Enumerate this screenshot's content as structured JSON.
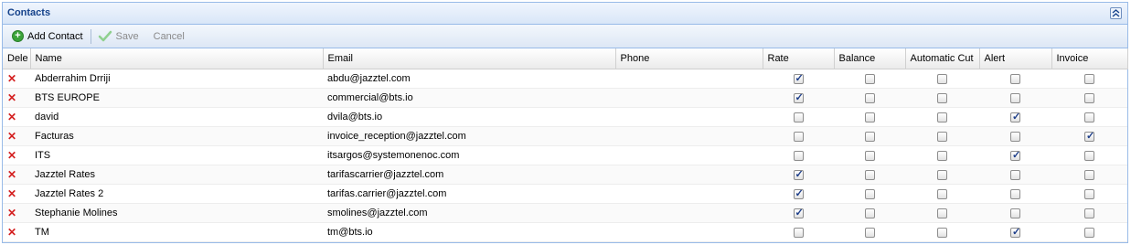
{
  "panel": {
    "title": "Contacts"
  },
  "toolbar": {
    "add_label": "Add Contact",
    "save_label": "Save",
    "cancel_label": "Cancel"
  },
  "columns": [
    "Dele",
    "Name",
    "Email",
    "Phone",
    "Rate",
    "Balance",
    "Automatic Cut",
    "Alert",
    "Invoice"
  ],
  "contacts": [
    {
      "name": "Abderrahim Drriji",
      "email": "abdu@jazztel.com",
      "phone": "",
      "rate": true,
      "balance": false,
      "automatic_cut": false,
      "alert": false,
      "invoice": false
    },
    {
      "name": "BTS EUROPE",
      "email": "commercial@bts.io",
      "phone": "",
      "rate": true,
      "balance": false,
      "automatic_cut": false,
      "alert": false,
      "invoice": false
    },
    {
      "name": "david",
      "email": "dvila@bts.io",
      "phone": "",
      "rate": false,
      "balance": false,
      "automatic_cut": false,
      "alert": true,
      "invoice": false
    },
    {
      "name": "Facturas",
      "email": "invoice_reception@jazztel.com",
      "phone": "",
      "rate": false,
      "balance": false,
      "automatic_cut": false,
      "alert": false,
      "invoice": true
    },
    {
      "name": "ITS",
      "email": "itsargos@systemonenoc.com",
      "phone": "",
      "rate": false,
      "balance": false,
      "automatic_cut": false,
      "alert": true,
      "invoice": false
    },
    {
      "name": "Jazztel Rates",
      "email": "tarifascarrier@jazztel.com",
      "phone": "",
      "rate": true,
      "balance": false,
      "automatic_cut": false,
      "alert": false,
      "invoice": false
    },
    {
      "name": "Jazztel Rates 2",
      "email": "tarifas.carrier@jazztel.com",
      "phone": "",
      "rate": true,
      "balance": false,
      "automatic_cut": false,
      "alert": false,
      "invoice": false
    },
    {
      "name": "Stephanie Molines",
      "email": "smolines@jazztel.com",
      "phone": "",
      "rate": true,
      "balance": false,
      "automatic_cut": false,
      "alert": false,
      "invoice": false
    },
    {
      "name": "TM",
      "email": "tm@bts.io",
      "phone": "",
      "rate": false,
      "balance": false,
      "automatic_cut": false,
      "alert": true,
      "invoice": false
    }
  ],
  "icons": {
    "delete": "delete-x-icon",
    "add": "add-circle-icon",
    "save": "checkmark-icon",
    "collapse": "double-chevron-up-icon"
  },
  "colors": {
    "header_text": "#15428b",
    "border": "#99bbe8",
    "delete": "#d42020"
  }
}
